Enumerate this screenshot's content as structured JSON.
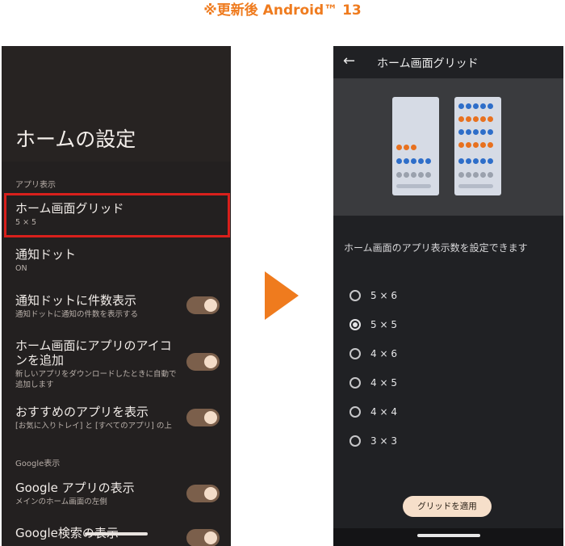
{
  "heading": "※更新後 Android™ 13",
  "left": {
    "title": "ホームの設定",
    "section_app": "アプリ表示",
    "items": [
      {
        "title": "ホーム画面グリッド",
        "sub": "5 × 5"
      },
      {
        "title": "通知ドット",
        "sub": "ON"
      },
      {
        "title": "通知ドットに件数表示",
        "sub": "通知ドットに通知の件数を表示する"
      },
      {
        "title": "ホーム画面にアプリのアイコンを追加",
        "sub": "新しいアプリをダウンロードしたときに自動で追加します"
      },
      {
        "title": "おすすめのアプリを表示",
        "sub": "[お気に入りトレイ] と [すべてのアプリ] の上"
      }
    ],
    "section_google": "Google表示",
    "google_items": [
      {
        "title": "Google アプリの表示",
        "sub": "メインのホーム画面の左側"
      },
      {
        "title": "Google検索の表示",
        "sub": ""
      }
    ]
  },
  "right": {
    "title": "ホーム画面グリッド",
    "description": "ホーム画面のアプリ表示数を設定できます",
    "options": [
      "5 × 6",
      "5 × 5",
      "4 × 6",
      "4 × 5",
      "4 × 4",
      "3 × 3"
    ],
    "selected": "5 × 5",
    "apply_label": "グリッドを適用"
  },
  "colors": {
    "accent": "#ef7b1e",
    "highlight": "#d8201c",
    "dot_orange": "#e8711f",
    "dot_blue": "#2e6ec9",
    "dot_gray": "#9aa1ad"
  }
}
